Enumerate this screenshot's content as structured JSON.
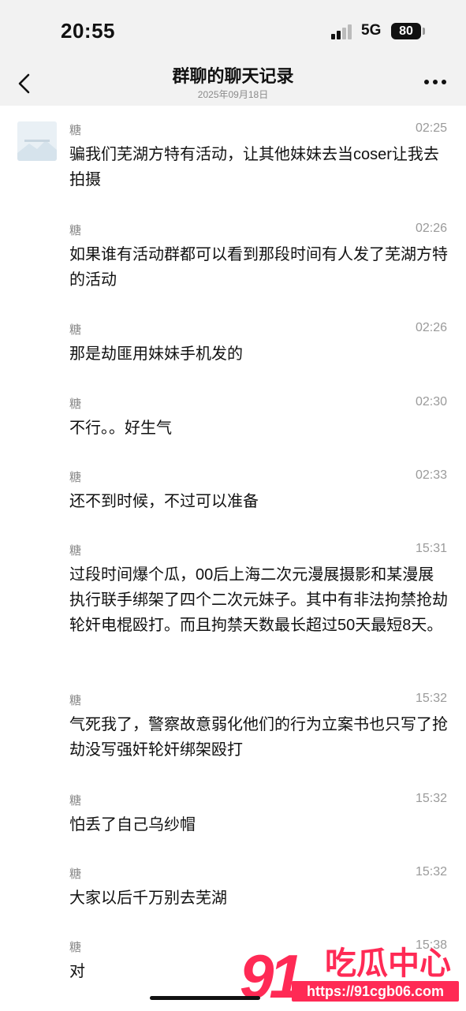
{
  "status": {
    "time": "20:55",
    "network": "5G",
    "battery": "80"
  },
  "header": {
    "title": "群聊的聊天记录",
    "date": "2025年09月18日"
  },
  "messages": [
    {
      "sender": "糖",
      "time": "02:25",
      "text": "骗我们芜湖方特有活动，让其他妹妹去当coser让我去拍摄"
    },
    {
      "sender": "糖",
      "time": "02:26",
      "text": "如果谁有活动群都可以看到那段时间有人发了芜湖方特的活动"
    },
    {
      "sender": "糖",
      "time": "02:26",
      "text": "那是劫匪用妹妹手机发的"
    },
    {
      "sender": "糖",
      "time": "02:30",
      "text": "不行。。好生气"
    },
    {
      "sender": "糖",
      "time": "02:33",
      "text": "还不到时候，不过可以准备"
    },
    {
      "sender": "糖",
      "time": "15:31",
      "text": "过段时间爆个瓜，00后上海二次元漫展摄影和某漫展执行联手绑架了四个二次元妹子。其中有非法拘禁抢劫轮奸电棍殴打。而且拘禁天数最长超过50天最短8天。"
    },
    {
      "sender": "糖",
      "time": "15:32",
      "text": "气死我了，警察故意弱化他们的行为立案书也只写了抢劫没写强奸轮奸绑架殴打"
    },
    {
      "sender": "糖",
      "time": "15:32",
      "text": "怕丢了自己乌纱帽"
    },
    {
      "sender": "糖",
      "time": "15:32",
      "text": "大家以后千万别去芜湖"
    },
    {
      "sender": "糖",
      "time": "15:38",
      "text": "对"
    }
  ],
  "watermark": {
    "brand": "91",
    "name": "吃瓜中心",
    "url": "https://91cgb06.com"
  }
}
